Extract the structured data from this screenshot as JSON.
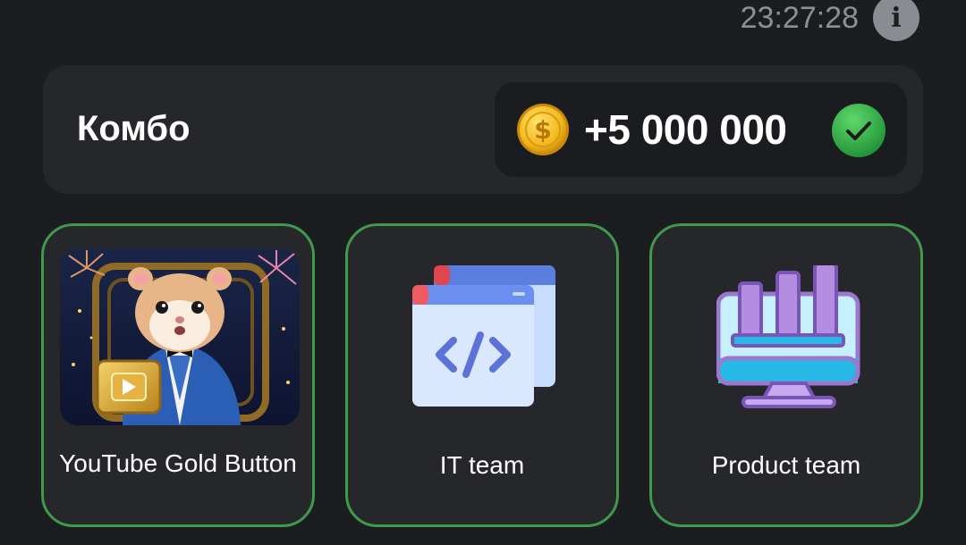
{
  "status": {
    "time": "23:27:28",
    "info_icon": "info-icon",
    "info_glyph": "i"
  },
  "combo": {
    "title": "Комбо",
    "reward": "+5 000 000",
    "coin_icon": "dollar-coin-icon",
    "claimed_icon": "checkmark-circle-icon",
    "colors": {
      "coin": "#f2b81d",
      "check": "#2fb548",
      "card_border": "#3f9a4c"
    }
  },
  "cards": [
    {
      "label": "YouTube Gold Button",
      "image": "hamster-youtube-gold-button-image"
    },
    {
      "label": "IT team",
      "icon": "code-windows-icon"
    },
    {
      "label": "Product team",
      "icon": "bar-chart-monitor-icon"
    }
  ]
}
